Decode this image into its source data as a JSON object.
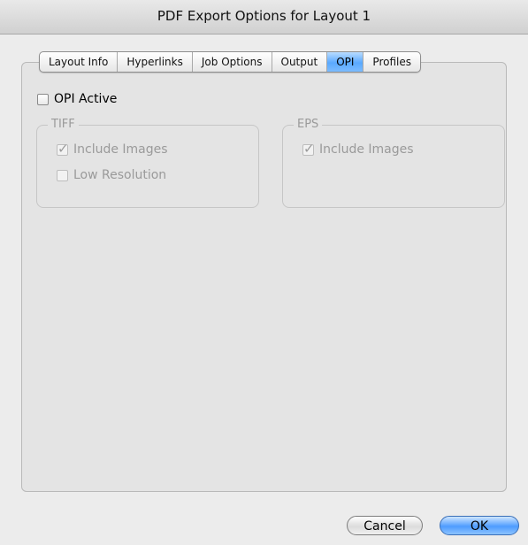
{
  "window": {
    "title": "PDF Export Options for Layout 1"
  },
  "tabs": [
    {
      "label": "Layout Info",
      "selected": false
    },
    {
      "label": "Hyperlinks",
      "selected": false
    },
    {
      "label": "Job Options",
      "selected": false
    },
    {
      "label": "Output",
      "selected": false
    },
    {
      "label": "OPI",
      "selected": true
    },
    {
      "label": "Profiles",
      "selected": false
    }
  ],
  "opi": {
    "active_label": "OPI Active",
    "active_checked": false,
    "tiff": {
      "legend": "TIFF",
      "include_images_label": "Include Images",
      "include_images_checked": true,
      "low_resolution_label": "Low Resolution",
      "low_resolution_checked": false
    },
    "eps": {
      "legend": "EPS",
      "include_images_label": "Include Images",
      "include_images_checked": true
    }
  },
  "buttons": {
    "cancel": "Cancel",
    "ok": "OK"
  },
  "colors": {
    "selected_tab": "#5aa9ff",
    "default_button": "#4e9cff",
    "disabled_text": "#9a9a9a"
  }
}
